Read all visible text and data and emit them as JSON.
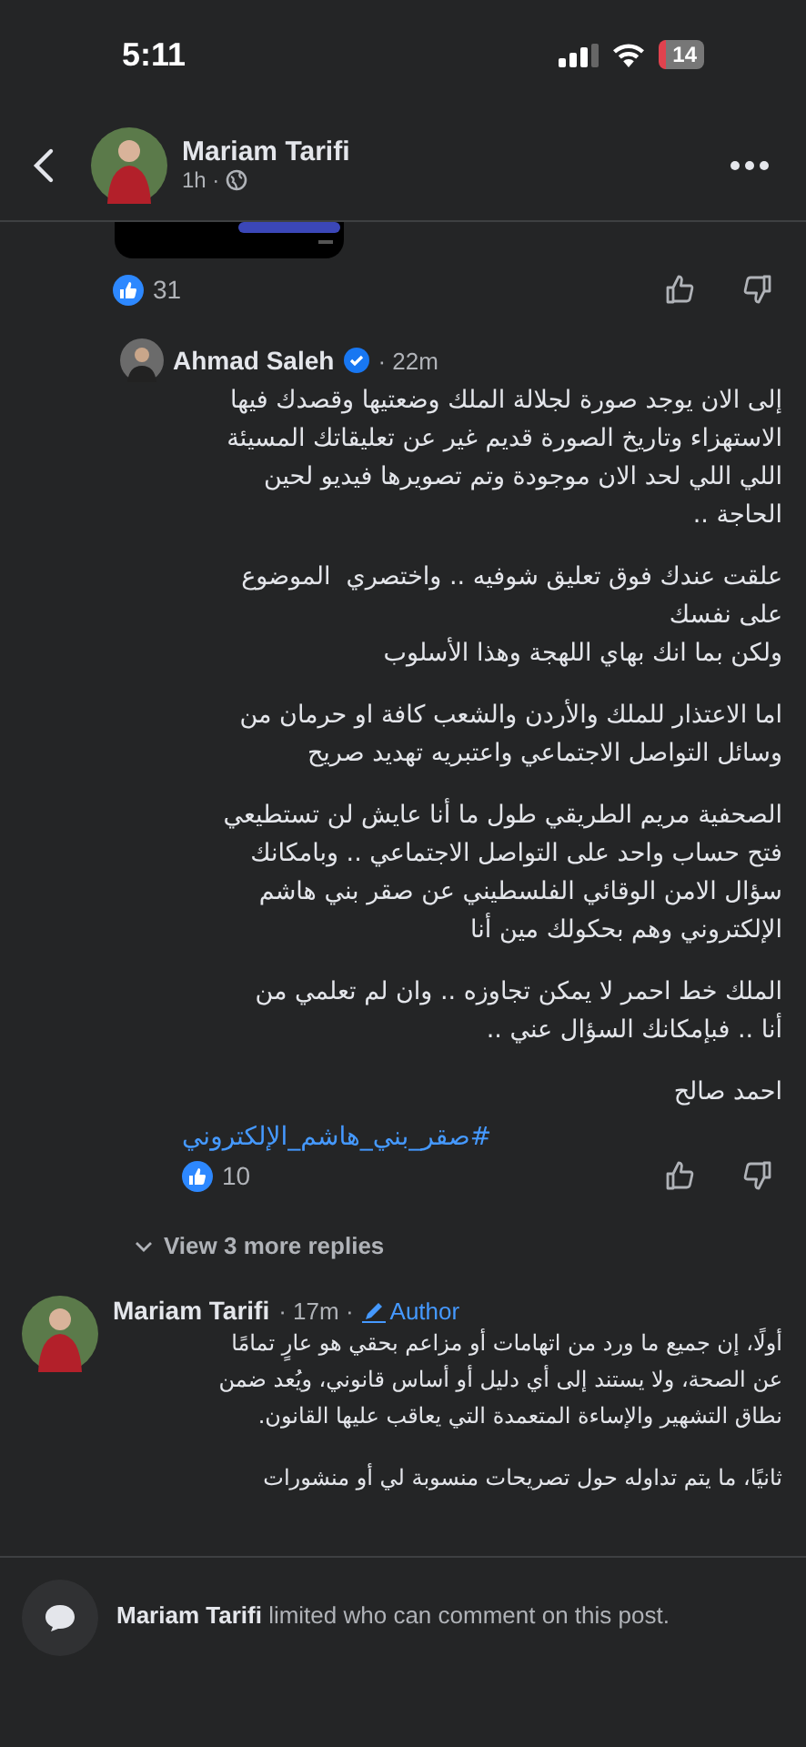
{
  "status_bar": {
    "time": "5:11",
    "battery": "14"
  },
  "header": {
    "name": "Mariam Tarifi",
    "time": "1h ·"
  },
  "post_reactions": {
    "count": "31"
  },
  "reply": {
    "name": "Ahmad Saleh",
    "verified": true,
    "time": "· 22m",
    "paragraphs": [
      "إلى الان يوجد صورة لجلالة الملك وضعتيها وقصدك فيها\nالاستهزاء وتاريخ الصورة قديم غير عن تعليقاتك المسيئة\nاللي اللي لحد الان موجودة وتم تصويرها فيديو لحين\nالحاجة ..",
      "علقت عندك فوق تعليق شوفيه .. واختصري  الموضوع\nعلى نفسك\nولكن بما انك بهاي اللهجة وهذا الأسلوب",
      "اما الاعتذار للملك والأردن والشعب كافة او حرمان من\nوسائل التواصل الاجتماعي واعتبريه تهديد صريح",
      "الصحفية مريم الطريقي طول ما أنا عايش لن تستطيعي\nفتح حساب واحد على التواصل الاجتماعي .. وبامكانك\nسؤال الامن الوقائي الفلسطيني عن صقر بني هاشم\nالإلكتروني وهم بحكولك مين أنا",
      "الملك خط احمر لا يمكن تجاوزه .. وان لم تعلمي من\nأنا .. فبإمكانك السؤال عني ..",
      "احمد صالح"
    ],
    "hashtag": "#صقر_بني_هاشم_الإلكتروني",
    "reactions": "10"
  },
  "view_more": "View 3 more replies",
  "comment": {
    "name": "Mariam Tarifi",
    "time": "· 17m ·",
    "badge": "Author",
    "paragraphs": [
      "أولًا، إن جميع ما ورد من اتهامات أو مزاعم بحقي هو عارٍ تمامًا\nعن الصحة، ولا يستند إلى أي دليل أو أساس قانوني، ويُعد ضمن\nنطاق التشهير والإساءة المتعمدة التي يعاقب عليها القانون.",
      "ثانيًا، ما يتم تداوله حول تصريحات منسوبة لي أو منشورات"
    ]
  },
  "notice": {
    "name": "Mariam Tarifi",
    "text": "limited who can comment on this post."
  }
}
